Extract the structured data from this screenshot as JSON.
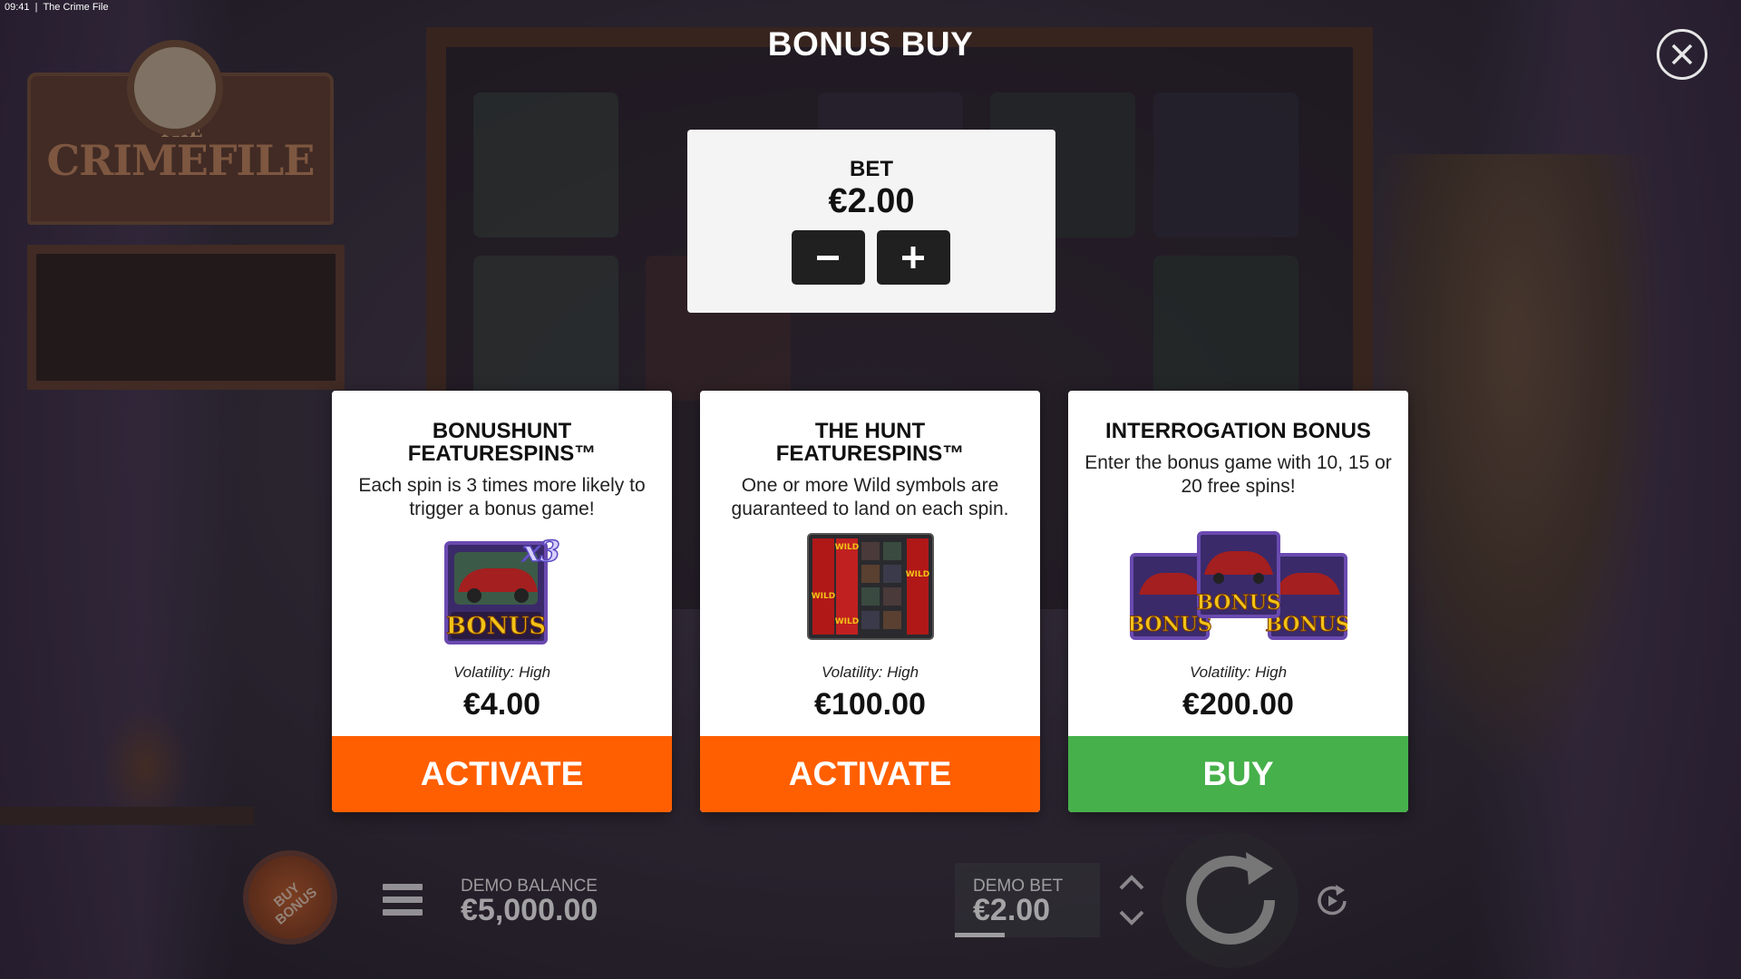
{
  "status_bar": {
    "time": "09:41",
    "app_name": "The Crime File"
  },
  "game_logo": {
    "top": "THE",
    "main": "CRIMEFILE"
  },
  "dialog": {
    "title": "BONUS BUY",
    "bet": {
      "label": "BET",
      "value": "€2.00"
    }
  },
  "cards": [
    {
      "title": "BONUSHUNT FEATURESPINS™",
      "description": "Each spin is 3 times more likely to trigger a bonus game!",
      "image_text": "BONUS",
      "image_badge": "x3",
      "volatility": "Volatility: High",
      "price": "€4.00",
      "button_label": "ACTIVATE",
      "button_color": "#ff5f00"
    },
    {
      "title": "THE HUNT FEATURESPINS™",
      "description": "One or more Wild symbols are guaranteed to land on each spin.",
      "image_text": "WILD",
      "volatility": "Volatility: High",
      "price": "€100.00",
      "button_label": "ACTIVATE",
      "button_color": "#ff5f00"
    },
    {
      "title": "INTERROGATION BONUS",
      "description": "Enter the bonus game with 10, 15 or 20 free spins!",
      "image_text": "BONUS",
      "volatility": "Volatility: High",
      "price": "€200.00",
      "button_label": "BUY",
      "button_color": "#46b04a"
    }
  ],
  "bottom_bar": {
    "buy_bonus_label": "BUY BONUS",
    "demo_balance_label": "DEMO BALANCE",
    "demo_balance_value": "€5,000.00",
    "demo_bet_label": "DEMO BET",
    "demo_bet_value": "€2.00"
  }
}
